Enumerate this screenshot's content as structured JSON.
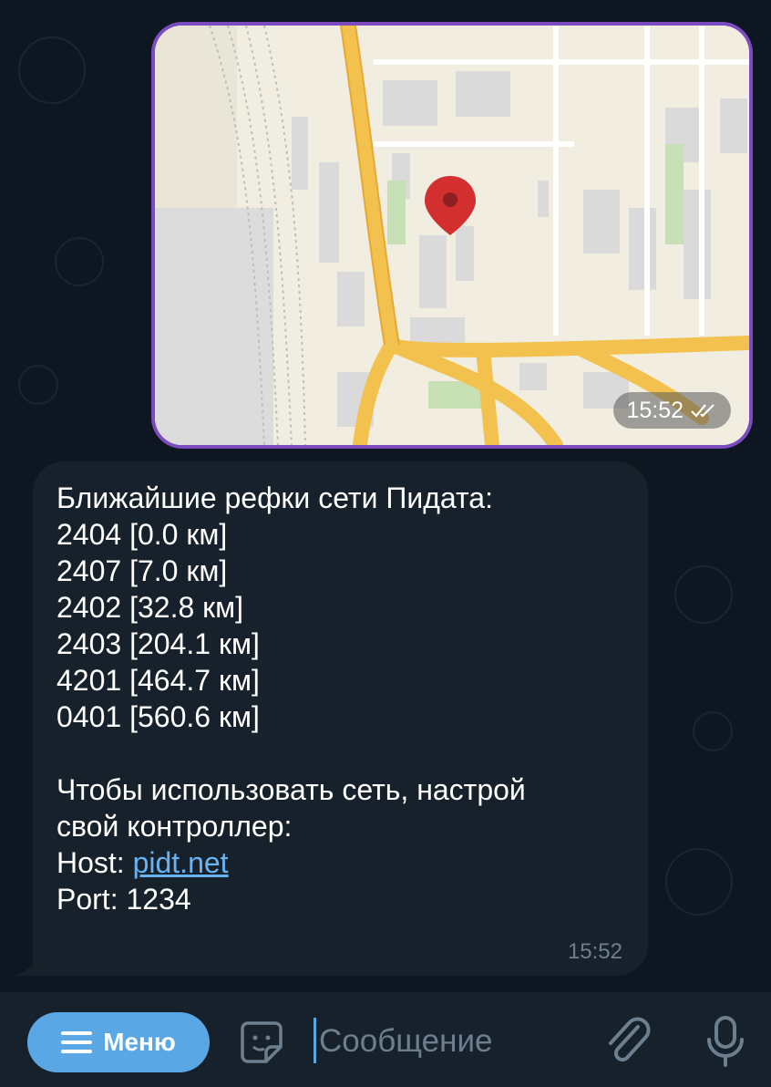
{
  "map_message": {
    "time": "15:52",
    "status_icon": "double-check-icon"
  },
  "text_message": {
    "lines": [
      "Ближайшие рефки сети Пидата:",
      "2404 [0.0 км]",
      "2407 [7.0 км]",
      "2402 [32.8 км]",
      "2403 [204.1 км]",
      "4201 [464.7 км]",
      "0401 [560.6 км]",
      "",
      "Чтобы использовать сеть, настрой",
      "свой контроллер:"
    ],
    "host_label": "Host: ",
    "host_link": "pidt.net",
    "port_line": "Port: 1234",
    "time": "15:52"
  },
  "composer": {
    "menu_label": "Меню",
    "placeholder": "Сообщение",
    "value": ""
  },
  "colors": {
    "accent": "#5aa7e6",
    "link": "#6ab3f3",
    "bubble": "#17212b",
    "background": "#0e1621",
    "map_border": "#7b4bbf",
    "pin": "#d32f2f",
    "road": "#f5c542"
  }
}
